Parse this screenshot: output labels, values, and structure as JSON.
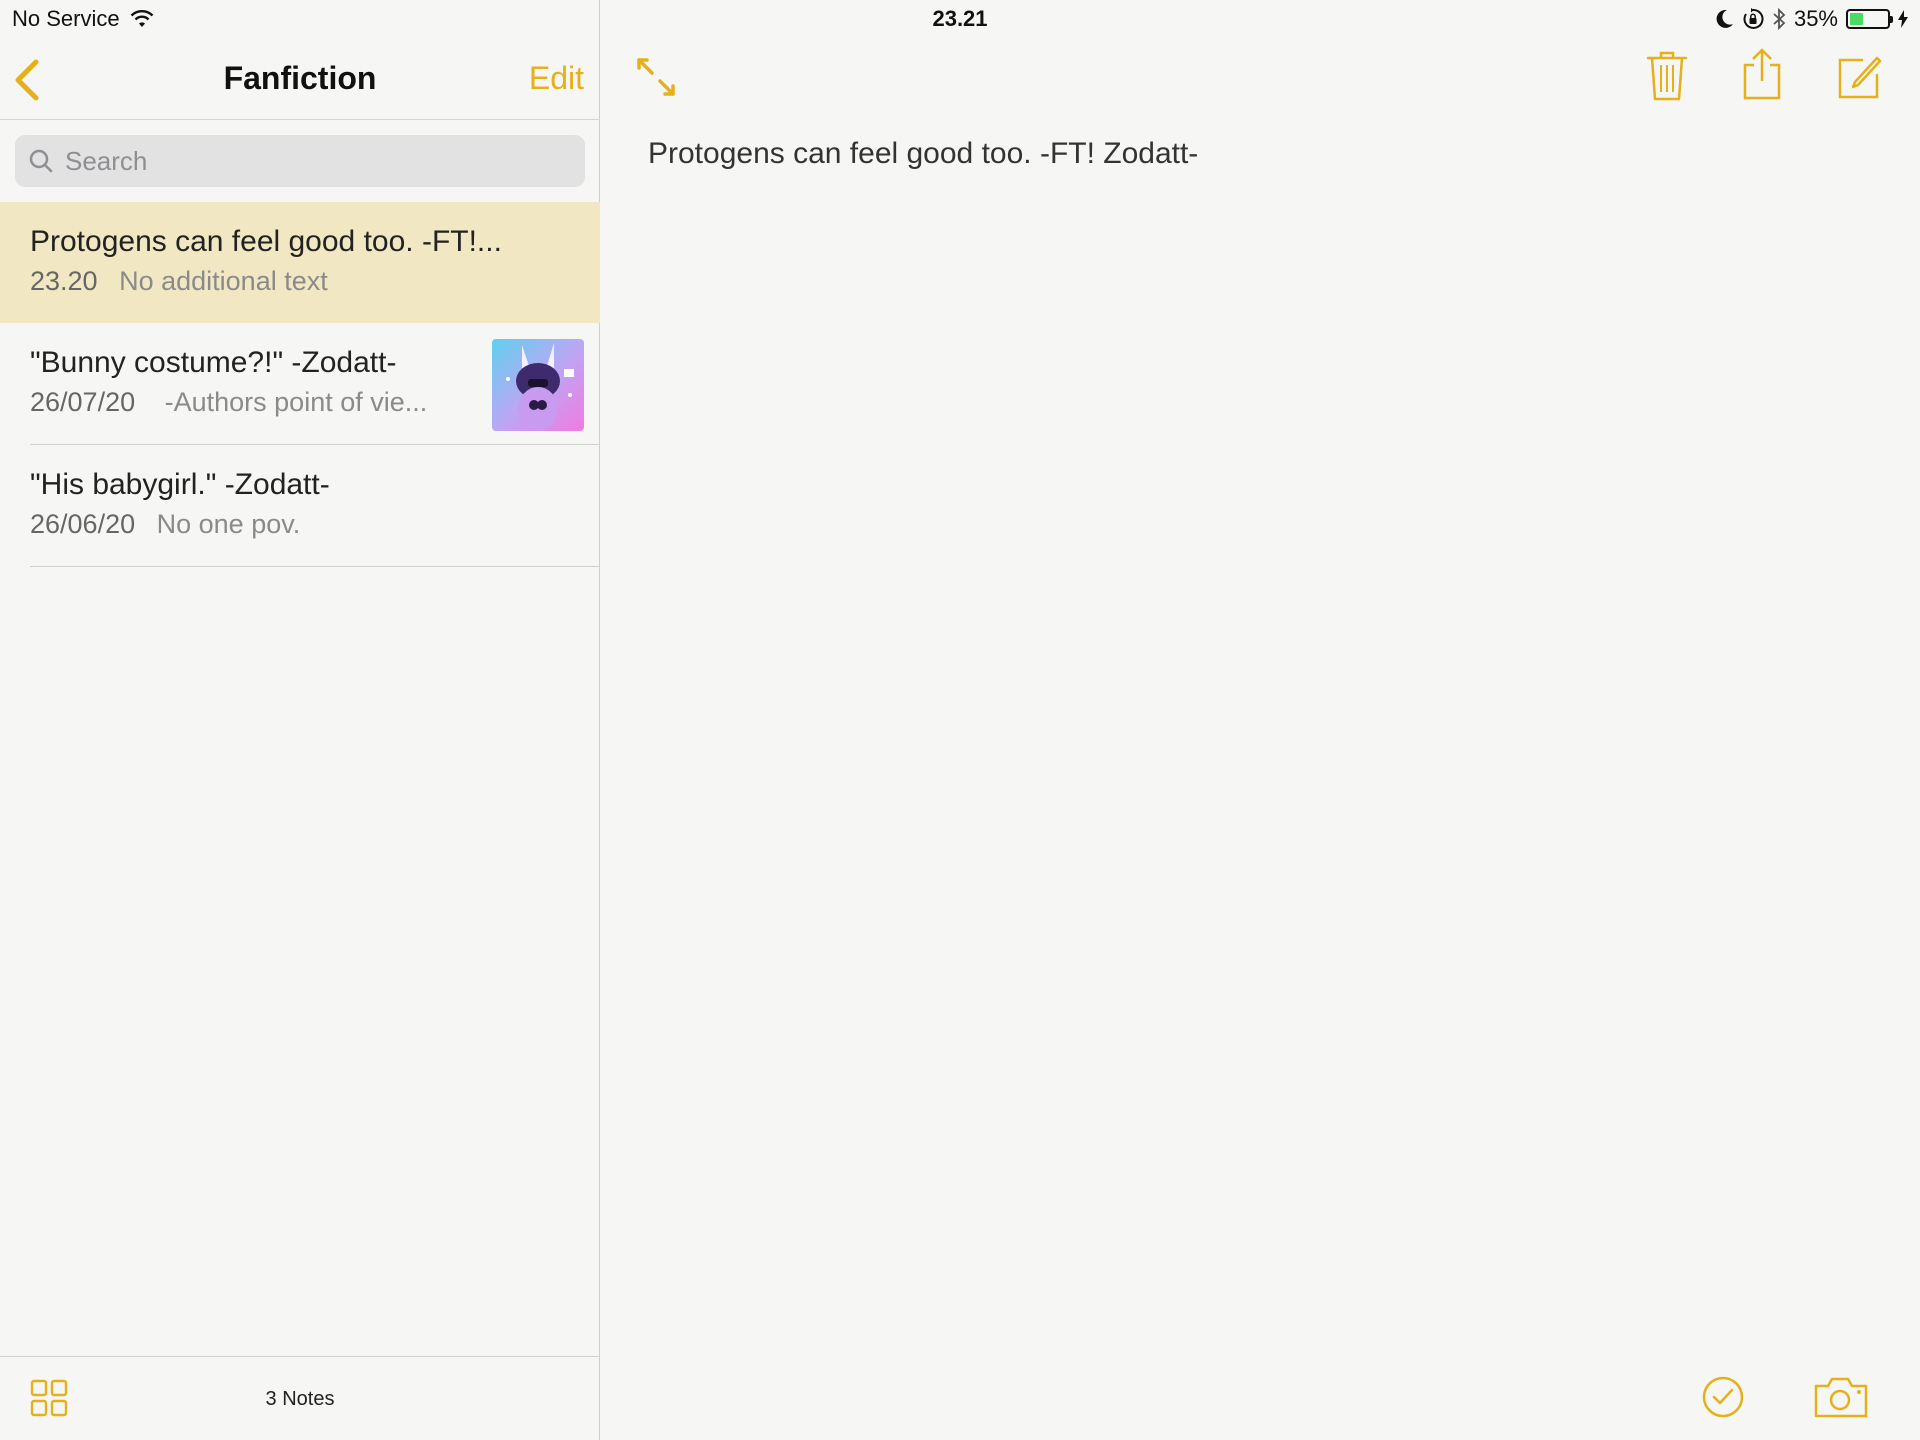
{
  "status_bar": {
    "carrier": "No Service",
    "time": "23.21",
    "battery_percent": "35%",
    "battery_level": 0.35
  },
  "sidebar": {
    "title": "Fanfiction",
    "edit_label": "Edit",
    "search_placeholder": "Search",
    "notes": [
      {
        "title": "Protogens can feel good too. -FT!...",
        "date": "23.20",
        "preview": "No additional text",
        "selected": true
      },
      {
        "title": "\"Bunny costume?!\" -Zodatt-",
        "date": "26/07/20",
        "preview": "-Authors point of vie...",
        "has_thumbnail": true
      },
      {
        "title": "\"His babygirl.\" -Zodatt-",
        "date": "26/06/20",
        "preview": "No one pov."
      }
    ],
    "footer": {
      "count_label": "3 Notes"
    }
  },
  "detail": {
    "body": "Protogens can feel good too. -FT! Zodatt-"
  },
  "colors": {
    "accent": "#e6b01b",
    "selected_row": "#f2e7c3"
  },
  "icons": [
    "wifi-icon",
    "moon-icon",
    "rotation-lock-icon",
    "bluetooth-icon",
    "battery-icon",
    "charging-icon",
    "back-chevron-icon",
    "search-icon",
    "expand-icon",
    "trash-icon",
    "share-icon",
    "compose-icon",
    "gallery-grid-icon",
    "checklist-icon",
    "camera-icon"
  ]
}
